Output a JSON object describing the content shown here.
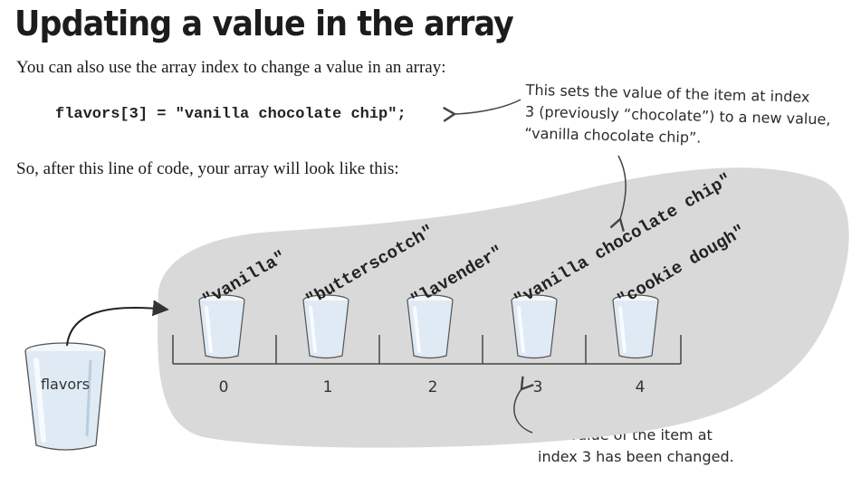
{
  "heading": "Updating a value in the array",
  "intro": "You can also use the array index to change a value in an array:",
  "code": "flavors[3] = \"vanilla chocolate chip\";",
  "after": "So, after this line of code, your array will look like this:",
  "note_top": [
    "This sets the value of the item at index",
    "3 (previously “chocolate”) to a new value,",
    "“vanilla chocolate chip”."
  ],
  "note_bottom": [
    "The value of the item at",
    "index 3 has been changed."
  ],
  "variable_name": "flavors",
  "array": {
    "items": [
      {
        "index": "0",
        "value": "\"vanilla\""
      },
      {
        "index": "1",
        "value": "\"butterscotch\""
      },
      {
        "index": "2",
        "value": "\"lavender\""
      },
      {
        "index": "3",
        "value": "\"vanilla chocolate chip\""
      },
      {
        "index": "4",
        "value": "\"cookie dough\""
      }
    ]
  },
  "colors": {
    "blob": "#d9d9d9",
    "cup_fill": "#dfeaf4",
    "cup_highlight": "#f7fbff",
    "ink": "#333333"
  }
}
